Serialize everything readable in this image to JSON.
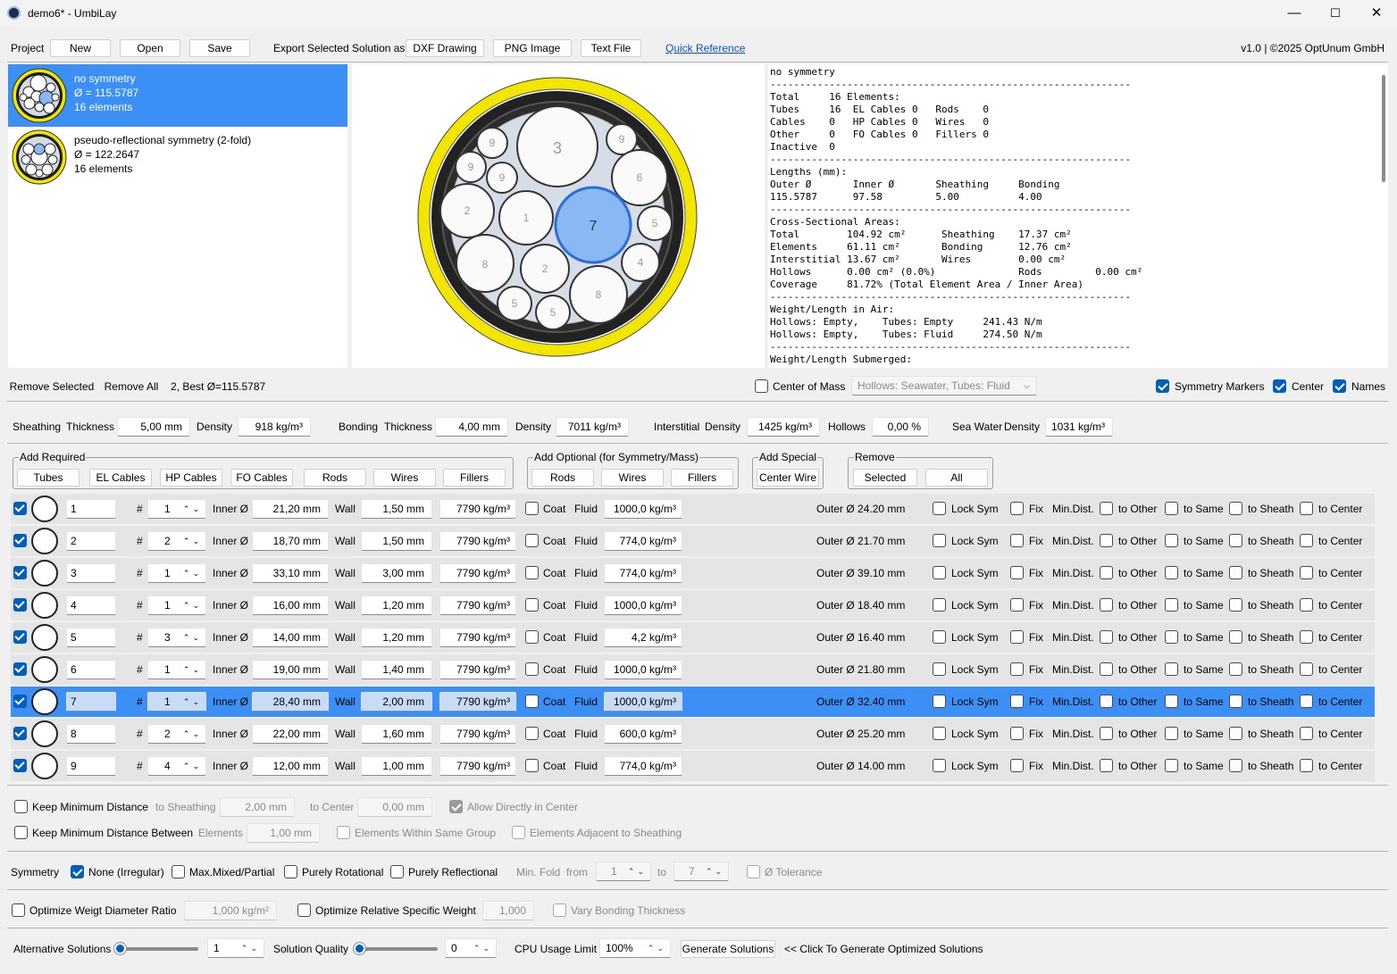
{
  "window": {
    "title": "demo6* - UmbiLay",
    "min": "—",
    "max": "☐",
    "close": "✕"
  },
  "toolbar": {
    "project_label": "Project",
    "new": "New",
    "open": "Open",
    "save": "Save",
    "export_label": "Export Selected Solution as",
    "dxf": "DXF Drawing",
    "png": "PNG Image",
    "text": "Text File",
    "quick_ref": "Quick Reference",
    "version": "v1.0 | ©2025 OptUnum GmbH"
  },
  "solutions": [
    {
      "name": "no symmetry",
      "diameter": "Ø = 115.5787",
      "elements": "16 elements"
    },
    {
      "name": "pseudo-reflectional symmetry (2-fold)",
      "diameter": "Ø = 122.2647",
      "elements": "16 elements"
    }
  ],
  "cross_section": {
    "labels": [
      "3",
      "9",
      "9",
      "9",
      "9",
      "6",
      "2",
      "1",
      "7",
      "5",
      "8",
      "2",
      "4",
      "8",
      "5",
      "5"
    ]
  },
  "report": {
    "text": "no symmetry\n-------------------------------------------------------------\nTotal     16 Elements:\nTubes     16  EL Cables 0   Rods    0\nCables    0   HP Cables 0   Wires   0\nOther     0   FO Cables 0   Fillers 0\nInactive  0\n-------------------------------------------------------------\nLengths (mm):\nOuter Ø       Inner Ø       Sheathing     Bonding\n115.5787      97.58         5.00          4.00\n-------------------------------------------------------------\nCross-Sectional Areas:\nTotal        104.92 cm²      Sheathing    17.37 cm²\nElements     61.11 cm²       Bonding      12.76 cm²\nInterstitial 13.67 cm²       Wires        0.00 cm²\nHollows      0.00 cm² (0.0%)              Rods         0.00 cm²\nCoverage     81.72% (Total Element Area / Inner Area)\n-------------------------------------------------------------\nWeight/Length in Air:\nHollows: Empty,    Tubes: Empty     241.43 N/m\nHollows: Empty,    Tubes: Fluid     274.50 N/m\n-------------------------------------------------------------\nWeight/Length Submerged:"
  },
  "solution_actions": {
    "remove_selected": "Remove Selected",
    "remove_all": "Remove All",
    "status": "2, Best Ø=115.5787",
    "center_of_mass": "Center of Mass",
    "hollows_select": "Hollows: Seawater, Tubes: Fluid",
    "symmetry_markers": "Symmetry Markers",
    "center": "Center",
    "names": "Names"
  },
  "materials": {
    "sheathing": "Sheathing",
    "thickness": "Thickness",
    "density": "Density",
    "sheathing_thickness": "5,00 mm",
    "sheathing_density": "918 kg/m³",
    "bonding": "Bonding",
    "bonding_thickness": "4,00 mm",
    "bonding_density": "7011 kg/m³",
    "interstitial": "Interstitial",
    "interstitial_density": "1425 kg/m³",
    "hollows": "Hollows",
    "hollows_value": "0,00 %",
    "seawater": "Sea Water",
    "seawater_density": "1031 kg/m³"
  },
  "add_groups": {
    "required_title": "Add Required",
    "required": [
      "Tubes",
      "EL Cables",
      "HP Cables",
      "FO Cables",
      "Rods",
      "Wires",
      "Fillers"
    ],
    "optional_title": "Add Optional (for Symmetry/Mass)",
    "optional": [
      "Rods",
      "Wires",
      "Fillers"
    ],
    "special_title": "Add Special",
    "special": [
      "Center Wire"
    ],
    "remove_title": "Remove",
    "remove": [
      "Selected",
      "All"
    ]
  },
  "row_labels": {
    "hash": "#",
    "inner": "Inner Ø",
    "wall": "Wall",
    "coat": "Coat",
    "fluid": "Fluid",
    "lock_sym": "Lock Sym",
    "fix": "Fix",
    "min_dist": "Min.Dist.",
    "to_other": "to Other",
    "to_same": "to Same",
    "to_sheath": "to Sheath",
    "to_center": "to Center"
  },
  "elements": [
    {
      "name": "1",
      "count": "1",
      "inner": "21,20 mm",
      "wall": "1,50 mm",
      "density": "7790 kg/m³",
      "fluid": "1000,0 kg/m³",
      "outer": "Outer Ø 24.20 mm"
    },
    {
      "name": "2",
      "count": "2",
      "inner": "18,70 mm",
      "wall": "1,50 mm",
      "density": "7790 kg/m³",
      "fluid": "774,0 kg/m³",
      "outer": "Outer Ø 21.70 mm"
    },
    {
      "name": "3",
      "count": "1",
      "inner": "33,10 mm",
      "wall": "3,00 mm",
      "density": "7790 kg/m³",
      "fluid": "774,0 kg/m³",
      "outer": "Outer Ø 39.10 mm"
    },
    {
      "name": "4",
      "count": "1",
      "inner": "16,00 mm",
      "wall": "1,20 mm",
      "density": "7790 kg/m³",
      "fluid": "1000,0 kg/m³",
      "outer": "Outer Ø 18.40 mm"
    },
    {
      "name": "5",
      "count": "3",
      "inner": "14,00 mm",
      "wall": "1,20 mm",
      "density": "7790 kg/m³",
      "fluid": "4,2 kg/m³",
      "outer": "Outer Ø 16.40 mm"
    },
    {
      "name": "6",
      "count": "1",
      "inner": "19,00 mm",
      "wall": "1,40 mm",
      "density": "7790 kg/m³",
      "fluid": "1000,0 kg/m³",
      "outer": "Outer Ø 21.80 mm"
    },
    {
      "name": "7",
      "count": "1",
      "inner": "28,40 mm",
      "wall": "2,00 mm",
      "density": "7790 kg/m³",
      "fluid": "1000,0 kg/m³",
      "outer": "Outer Ø 32.40 mm"
    },
    {
      "name": "8",
      "count": "2",
      "inner": "22,00 mm",
      "wall": "1,60 mm",
      "density": "7790 kg/m³",
      "fluid": "600,0 kg/m³",
      "outer": "Outer Ø 25.20 mm"
    },
    {
      "name": "9",
      "count": "4",
      "inner": "12,00 mm",
      "wall": "1,00 mm",
      "density": "7790 kg/m³",
      "fluid": "774,0 kg/m³",
      "outer": "Outer Ø 14.00 mm"
    }
  ],
  "constraints": {
    "keep_min_dist": "Keep Minimum Distance",
    "to_sheathing": "to Sheathing",
    "to_sheathing_val": "2,00 mm",
    "to_center": "to Center",
    "to_center_val": "0,00 mm",
    "allow_center": "Allow Directly in Center",
    "keep_min_between": "Keep Minimum Distance Between",
    "elements": "Elements",
    "elements_val": "1,00 mm",
    "within_group": "Elements Within Same Group",
    "adjacent_sheathing": "Elements Adjacent to Sheathing"
  },
  "symmetry": {
    "label": "Symmetry",
    "none": "None (Irregular)",
    "mixed": "Max.Mixed/Partial",
    "rotational": "Purely Rotational",
    "reflectional": "Purely Reflectional",
    "min_fold": "Min. Fold",
    "from": "from",
    "from_val": "1",
    "to": "to",
    "to_val": "7",
    "tolerance": "Ø Tolerance"
  },
  "optimize": {
    "weight_ratio": "Optimize Weigt Diameter Ratio",
    "weight_ratio_val": "1,000 kg/m²",
    "specific_weight": "Optimize Relative Specific Weight",
    "specific_weight_val": "1,000",
    "vary_bonding": "Vary Bonding Thickness"
  },
  "generate": {
    "alt_solutions": "Alternative Solutions",
    "alt_val": "1",
    "quality": "Solution Quality",
    "quality_val": "0",
    "cpu": "CPU Usage Limit",
    "cpu_val": "100%",
    "generate_btn": "Generate Solutions",
    "hint": "<< Click To Generate Optimized Solutions"
  }
}
